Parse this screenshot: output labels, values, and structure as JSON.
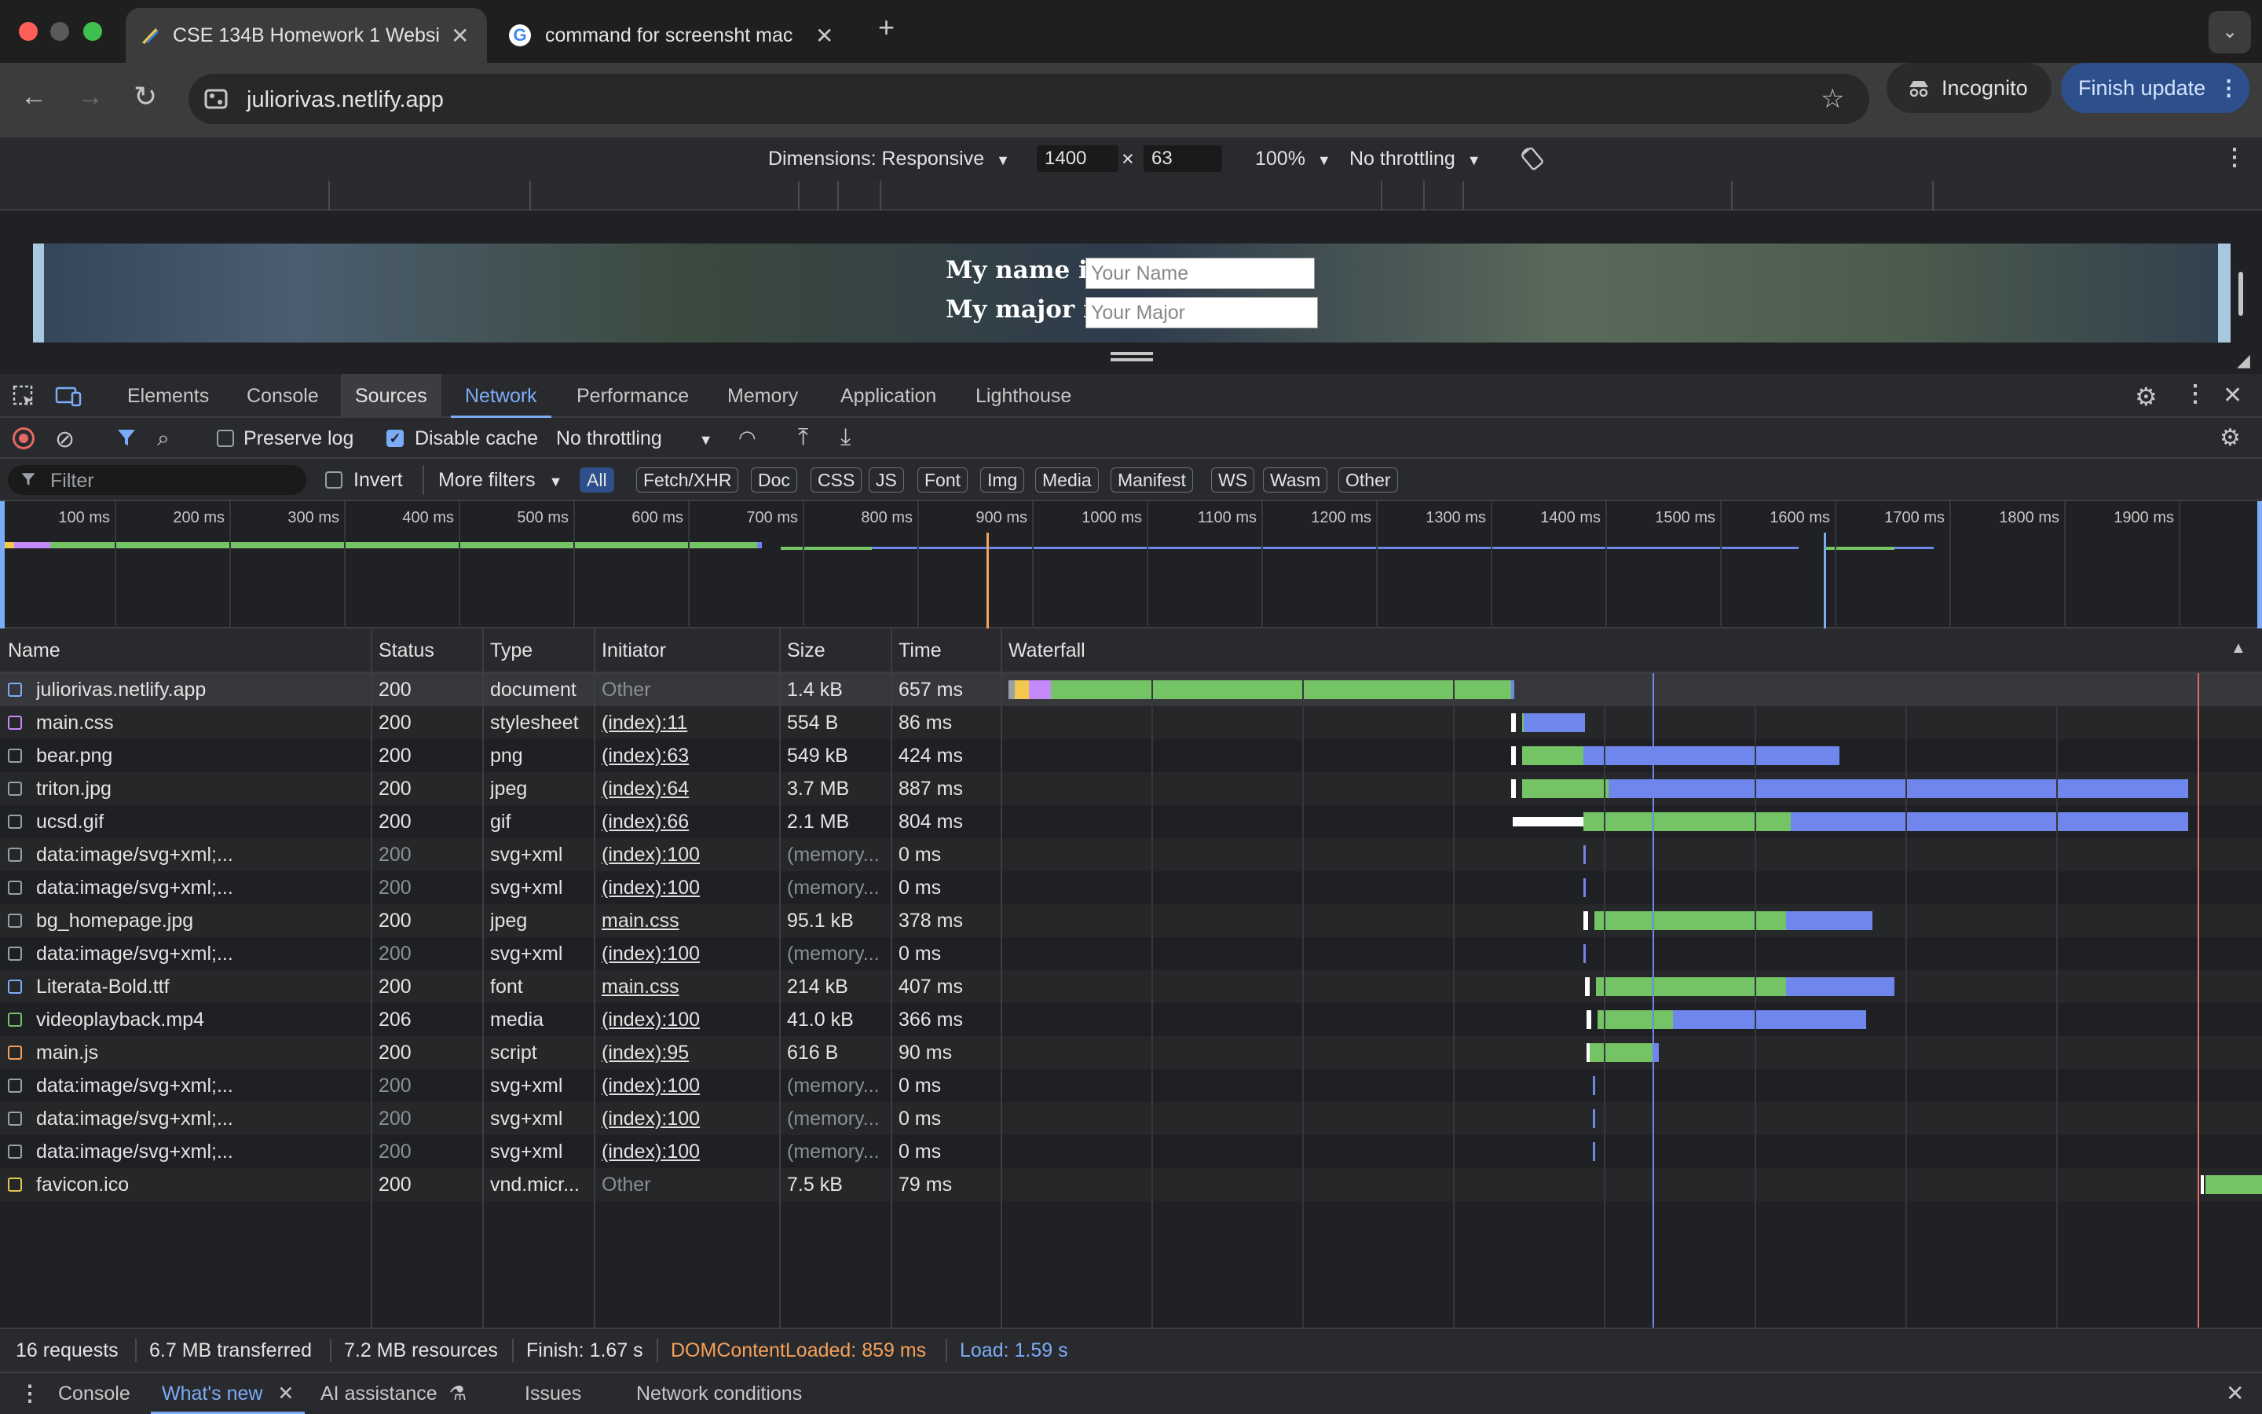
{
  "browser": {
    "tabs": [
      {
        "title": "CSE 134B Homework 1 Websi",
        "active": true
      },
      {
        "title": "command for screensht mac",
        "active": false
      }
    ],
    "url": "juliorivas.netlify.app",
    "incognito_label": "Incognito",
    "finish_update_label": "Finish update"
  },
  "device_toolbar": {
    "dimensions_label": "Dimensions: Responsive",
    "width": "1400",
    "height": "63",
    "times": "×",
    "zoom": "100%",
    "throttling": "No throttling"
  },
  "page": {
    "name_label": "My name is",
    "name_placeholder": "Your Name",
    "major_label": "My major is",
    "major_placeholder": "Your Major"
  },
  "devtools": {
    "tabs": [
      "Elements",
      "Console",
      "Sources",
      "Network",
      "Performance",
      "Memory",
      "Application",
      "Lighthouse"
    ],
    "network_toolbar": {
      "preserve_log": "Preserve log",
      "disable_cache": "Disable cache",
      "throttling": "No throttling"
    },
    "filter": {
      "placeholder": "Filter",
      "invert": "Invert",
      "more_filters": "More filters",
      "types": [
        "All",
        "Fetch/XHR",
        "Doc",
        "CSS",
        "JS",
        "Font",
        "Img",
        "Media",
        "Manifest",
        "WS",
        "Wasm",
        "Other"
      ]
    },
    "overview_ticks": [
      "100 ms",
      "200 ms",
      "300 ms",
      "400 ms",
      "500 ms",
      "600 ms",
      "700 ms",
      "800 ms",
      "900 ms",
      "1000 ms",
      "1100 ms",
      "1200 ms",
      "1300 ms",
      "1400 ms",
      "1500 ms",
      "1600 ms",
      "1700 ms",
      "1800 ms",
      "1900 ms",
      "200"
    ],
    "columns": [
      "Name",
      "Status",
      "Type",
      "Initiator",
      "Size",
      "Time",
      "Waterfall"
    ],
    "requests": [
      {
        "name": "juliorivas.netlify.app",
        "status": "200",
        "type": "document",
        "initiator": "Other",
        "size": "1.4 kB",
        "time": "657 ms"
      },
      {
        "name": "main.css",
        "status": "200",
        "type": "stylesheet",
        "initiator": "(index):11",
        "size": "554 B",
        "time": "86 ms"
      },
      {
        "name": "bear.png",
        "status": "200",
        "type": "png",
        "initiator": "(index):63",
        "size": "549 kB",
        "time": "424 ms"
      },
      {
        "name": "triton.jpg",
        "status": "200",
        "type": "jpeg",
        "initiator": "(index):64",
        "size": "3.7 MB",
        "time": "887 ms"
      },
      {
        "name": "ucsd.gif",
        "status": "200",
        "type": "gif",
        "initiator": "(index):66",
        "size": "2.1 MB",
        "time": "804 ms"
      },
      {
        "name": "data:image/svg+xml;...",
        "status": "200",
        "type": "svg+xml",
        "initiator": "(index):100",
        "size": "(memory...",
        "time": "0 ms"
      },
      {
        "name": "data:image/svg+xml;...",
        "status": "200",
        "type": "svg+xml",
        "initiator": "(index):100",
        "size": "(memory...",
        "time": "0 ms"
      },
      {
        "name": "bg_homepage.jpg",
        "status": "200",
        "type": "jpeg",
        "initiator": "main.css",
        "size": "95.1 kB",
        "time": "378 ms"
      },
      {
        "name": "data:image/svg+xml;...",
        "status": "200",
        "type": "svg+xml",
        "initiator": "(index):100",
        "size": "(memory...",
        "time": "0 ms"
      },
      {
        "name": "Literata-Bold.ttf",
        "status": "200",
        "type": "font",
        "initiator": "main.css",
        "size": "214 kB",
        "time": "407 ms"
      },
      {
        "name": "videoplayback.mp4",
        "status": "206",
        "type": "media",
        "initiator": "(index):100",
        "size": "41.0 kB",
        "time": "366 ms"
      },
      {
        "name": "main.js",
        "status": "200",
        "type": "script",
        "initiator": "(index):95",
        "size": "616 B",
        "time": "90 ms"
      },
      {
        "name": "data:image/svg+xml;...",
        "status": "200",
        "type": "svg+xml",
        "initiator": "(index):100",
        "size": "(memory...",
        "time": "0 ms"
      },
      {
        "name": "data:image/svg+xml;...",
        "status": "200",
        "type": "svg+xml",
        "initiator": "(index):100",
        "size": "(memory...",
        "time": "0 ms"
      },
      {
        "name": "data:image/svg+xml;...",
        "status": "200",
        "type": "svg+xml",
        "initiator": "(index):100",
        "size": "(memory...",
        "time": "0 ms"
      },
      {
        "name": "favicon.ico",
        "status": "200",
        "type": "vnd.micr...",
        "initiator": "Other",
        "size": "7.5 kB",
        "time": "79 ms"
      }
    ],
    "status": {
      "requests": "16 requests",
      "transferred": "6.7 MB transferred",
      "resources": "7.2 MB resources",
      "finish": "Finish: 1.67 s",
      "dom_content_loaded": "DOMContentLoaded: 859 ms",
      "load": "Load: 1.59 s"
    },
    "drawer_tabs": [
      "Console",
      "What's new",
      "AI assistance",
      "Issues",
      "Network conditions"
    ]
  },
  "colors": {
    "network_blue": "#7cacf8",
    "wait_green": "#74c365",
    "download_blue": "#6f86ec",
    "dcl_orange": "#f5a05a",
    "load_red": "#e46962",
    "finish_update_bg": "#2d4f8c"
  }
}
